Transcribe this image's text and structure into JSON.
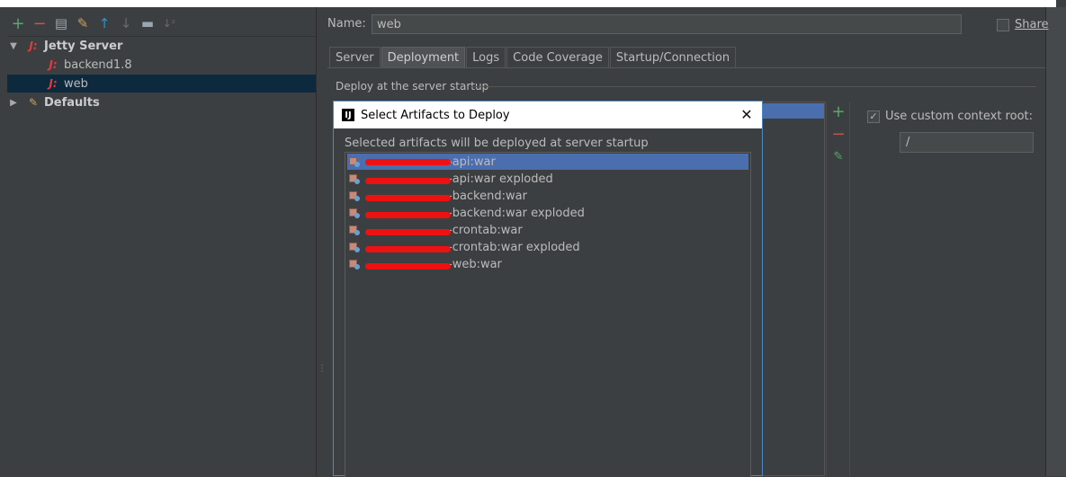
{
  "toolbar": {
    "icons": [
      "add-icon",
      "remove-icon",
      "copy-icon",
      "wrench-icon",
      "move-up-icon",
      "move-down-icon",
      "folder-icon",
      "sort-icon"
    ]
  },
  "tree": {
    "items": [
      {
        "label": "Jetty Server",
        "expanded": true
      },
      {
        "label": "backend1.8"
      },
      {
        "label": "web",
        "selected": true
      },
      {
        "label": "Defaults",
        "expanded": false
      }
    ]
  },
  "form": {
    "name_label": "Name:",
    "name_value": "web",
    "share_label": "Share"
  },
  "tabs": [
    "Server",
    "Deployment",
    "Logs",
    "Code Coverage",
    "Startup/Connection"
  ],
  "deployment": {
    "section_title": "Deploy at the server startup",
    "context_root_label": "Use custom context root:",
    "context_root_value": "/"
  },
  "dialog": {
    "title": "Select Artifacts to Deploy",
    "message": "Selected artifacts will be deployed at server startup",
    "artifacts": [
      "-api:war",
      "-api:war exploded",
      "-backend:war",
      "-backend:war exploded",
      "-crontab:war",
      "-crontab:war exploded",
      "-web:war"
    ]
  },
  "colors": {
    "background": "#3c3f41",
    "selection": "#4b6eaf",
    "tree_selection": "#0d293e",
    "accent_red": "#e03c3c",
    "add_green": "#59a869"
  }
}
